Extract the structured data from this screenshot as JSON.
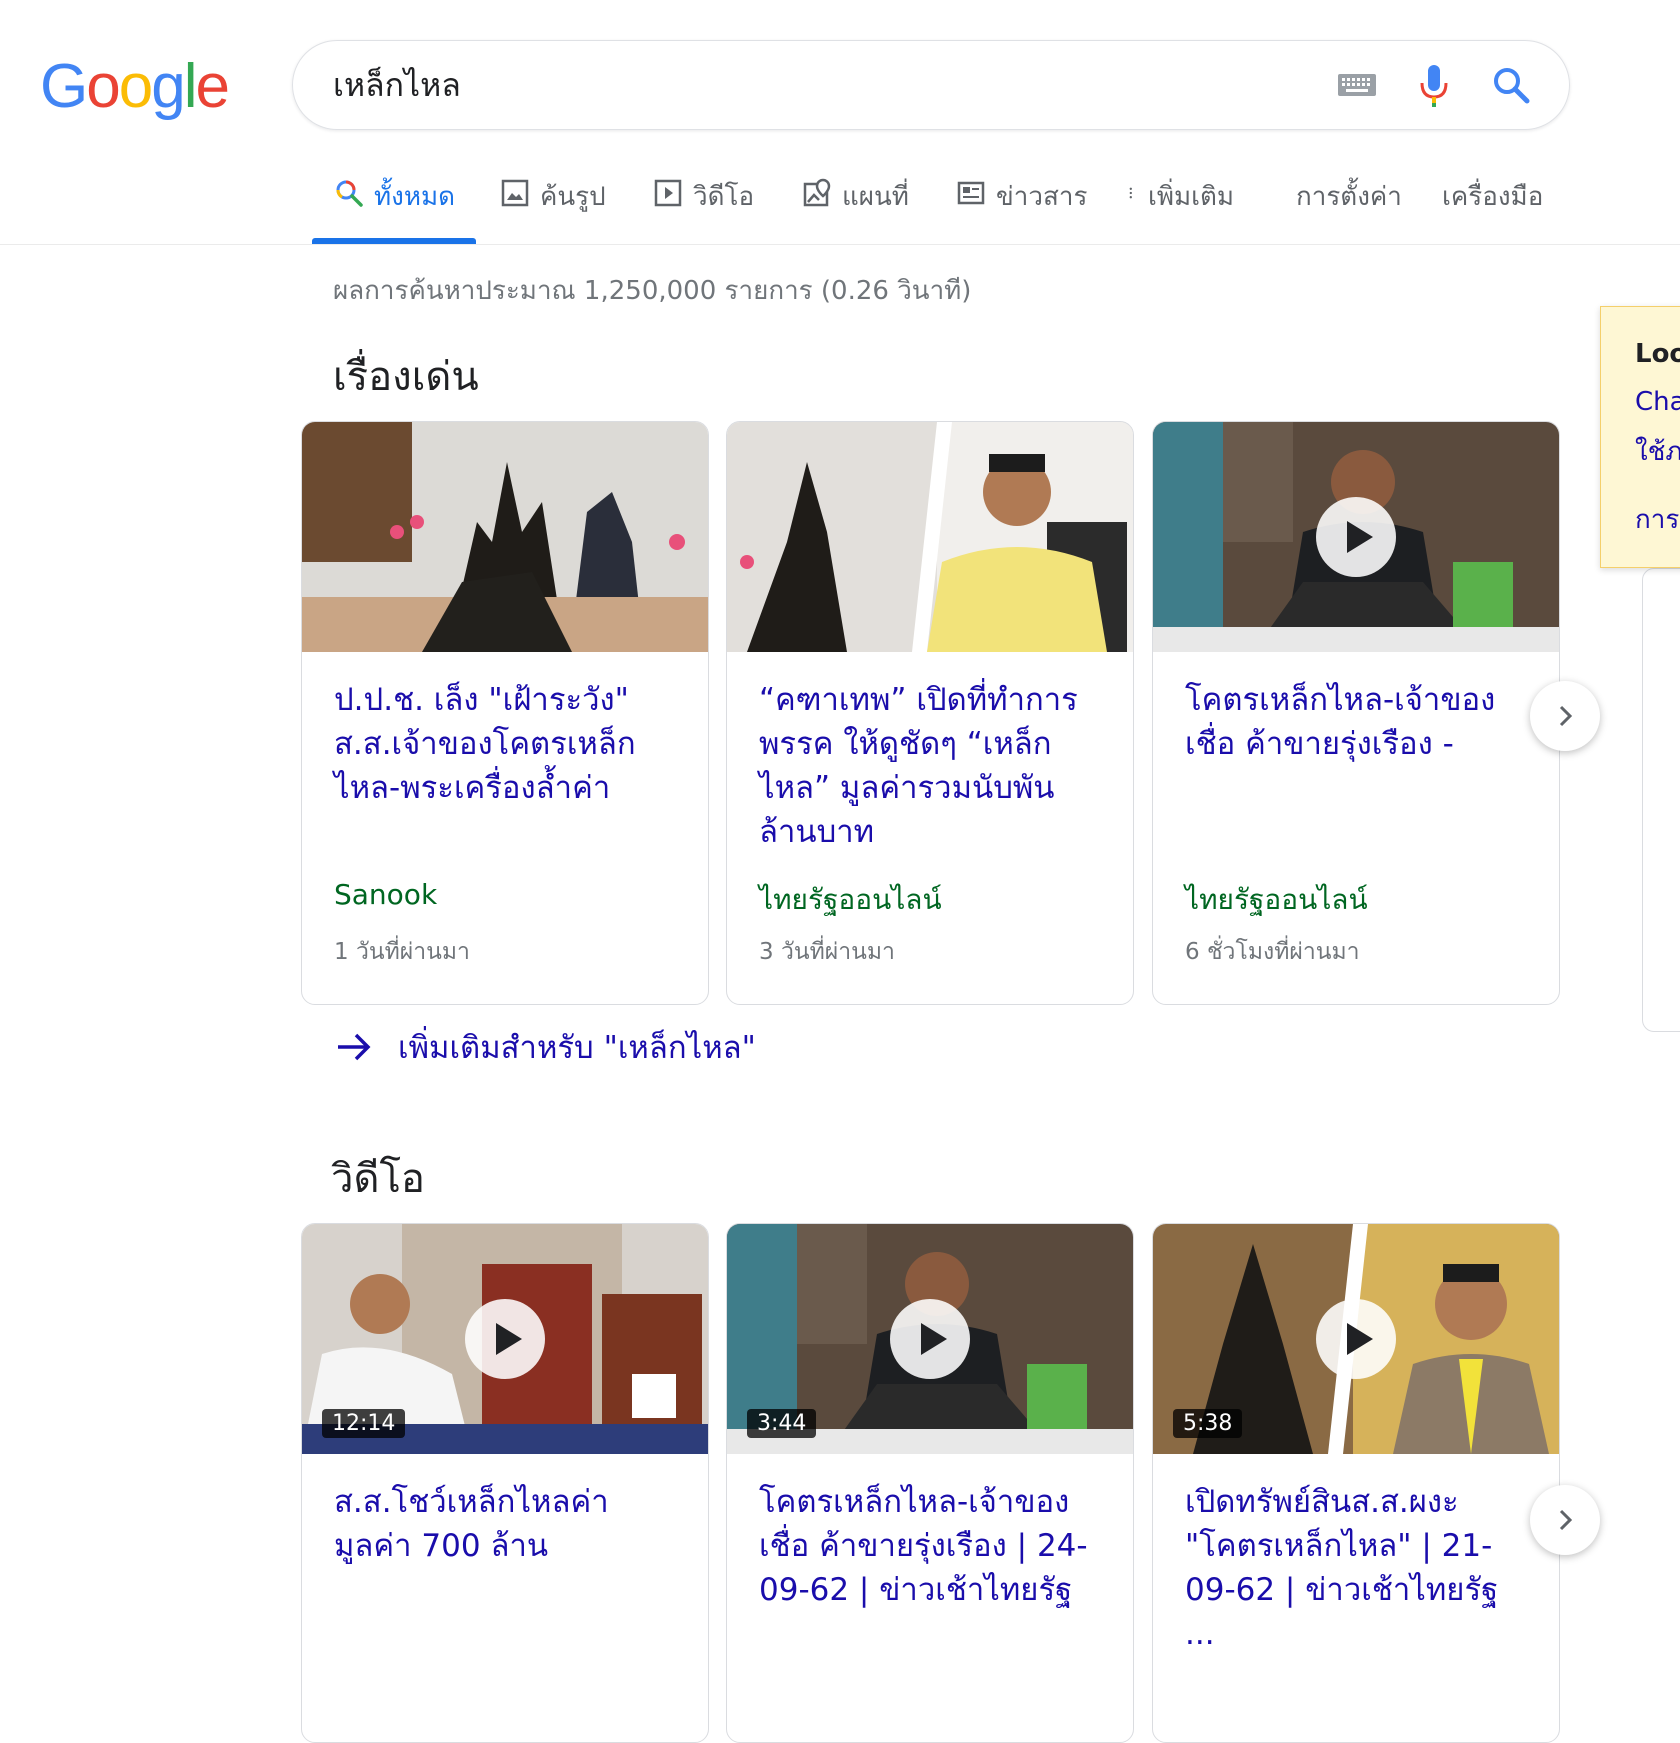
{
  "logo": "Google",
  "search": {
    "query": "เหล็กไหล"
  },
  "tabs": [
    {
      "label": "ทั้งหมด",
      "icon": "search-icon",
      "active": true
    },
    {
      "label": "ค้นรูป",
      "icon": "image-icon"
    },
    {
      "label": "วิดีโอ",
      "icon": "video-icon"
    },
    {
      "label": "แผนที่",
      "icon": "map-icon"
    },
    {
      "label": "ข่าวสาร",
      "icon": "news-icon"
    },
    {
      "label": "เพิ่มเติม",
      "icon": "more-vert-icon"
    },
    {
      "label": "การตั้งค่า"
    },
    {
      "label": "เครื่องมือ"
    }
  ],
  "stats": "ผลการค้นหาประมาณ 1,250,000 รายการ (0.26 วินาที)",
  "top_stories": {
    "title": "เรื่องเด่น",
    "more_link": "เพิ่มเติมสำหรับ \"เหล็กไหล\"",
    "cards": [
      {
        "title": "ป.ป.ช. เล็ง \"เฝ้าระวัง\" ส.ส.เจ้าของโคตรเหล็กไหล-พระเครื่องล้ำค่า",
        "source": "Sanook",
        "time": "1 วันที่ผ่านมา"
      },
      {
        "title": "“คฑาเทพ” เปิดที่ทำการพรรค ให้ดูชัดๆ “เหล็กไหล” มูลค่ารวมนับพันล้านบาท",
        "source": "ไทยรัฐออนไลน์",
        "time": "3 วันที่ผ่านมา"
      },
      {
        "title": "โคตรเหล็กไหล-เจ้าของเชื่อ ค้าขายรุ่งเรือง -",
        "source": "ไทยรัฐออนไลน์",
        "time": "6 ชั่วโมงที่ผ่านมา"
      }
    ]
  },
  "videos": {
    "title": "วิดีโอ",
    "cards": [
      {
        "title": "ส.ส.โชว์เหล็กไหลค่ามูลค่า 700 ล้าน",
        "duration": "12:14"
      },
      {
        "title": "โคตรเหล็กไหล-เจ้าของเชื่อ ค้าขายรุ่งเรือง | 24-09-62 | ข่าวเช้าไทยรัฐ",
        "duration": "3:44"
      },
      {
        "title": "เปิดทรัพย์สินส.ส.ผงะ \"โคตรเหล็กไหล\" | 21-09-62 | ข่าวเช้าไทยรัฐ ...",
        "duration": "5:38"
      }
    ]
  },
  "tooltip": {
    "title": "Loo",
    "line1": "Cha",
    "line2": "ใช้ภ",
    "line3": "การ"
  },
  "colors": {
    "link": "#1a0dab",
    "source": "#006621",
    "accent": "#1a73e8"
  }
}
